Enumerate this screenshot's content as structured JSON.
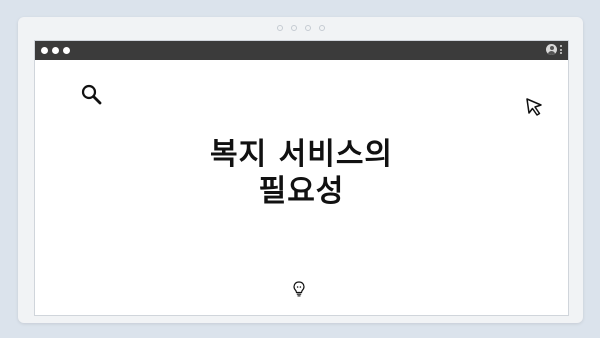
{
  "page": {
    "title_line1": "복지 서비스의",
    "title_line2": "필요성"
  },
  "icons": {
    "search": "magnifier-icon",
    "cursor": "cursor-arrow-icon",
    "bulb": "lightbulb-icon",
    "profile": "profile-icon",
    "menu": "kebab-menu-icon"
  },
  "colors": {
    "background": "#dbe3ec",
    "frame": "#f1f3f5",
    "titlebar": "#3b3b3b",
    "content": "#ffffff",
    "text": "#111111"
  }
}
